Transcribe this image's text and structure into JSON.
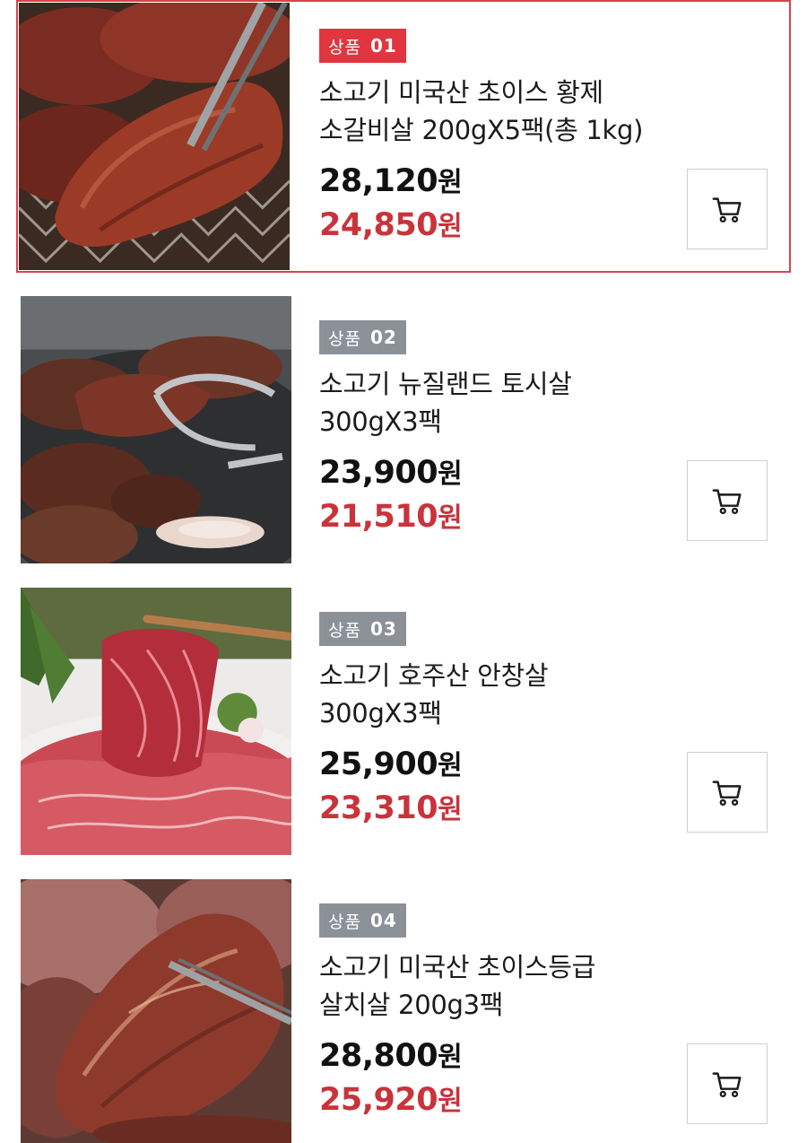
{
  "colors": {
    "accent": "#d9434c",
    "badge_active": "#e1353f",
    "badge_inactive": "#8c9198",
    "sale_price": "#c9333b"
  },
  "products": [
    {
      "badge_word": "상품",
      "badge_num": "01",
      "title_line1": "소고기 미국산 초이스 황제",
      "title_line2": "소갈비살 200gX5팩(총 1kg)",
      "price": "28,120",
      "sale_price": "24,850",
      "currency": "원",
      "cart_icon": "cart-icon",
      "selected": true
    },
    {
      "badge_word": "상품",
      "badge_num": "02",
      "title_line1": "소고기 뉴질랜드 토시살",
      "title_line2": "300gX3팩",
      "price": "23,900",
      "sale_price": "21,510",
      "currency": "원",
      "cart_icon": "cart-icon",
      "selected": false
    },
    {
      "badge_word": "상품",
      "badge_num": "03",
      "title_line1": "소고기 호주산 안창살",
      "title_line2": "300gX3팩",
      "price": "25,900",
      "sale_price": "23,310",
      "currency": "원",
      "cart_icon": "cart-icon",
      "selected": false
    },
    {
      "badge_word": "상품",
      "badge_num": "04",
      "title_line1": "소고기 미국산 초이스등급",
      "title_line2": "살치살 200g3팩",
      "price": "28,800",
      "sale_price": "25,920",
      "currency": "원",
      "cart_icon": "cart-icon",
      "selected": false
    }
  ]
}
